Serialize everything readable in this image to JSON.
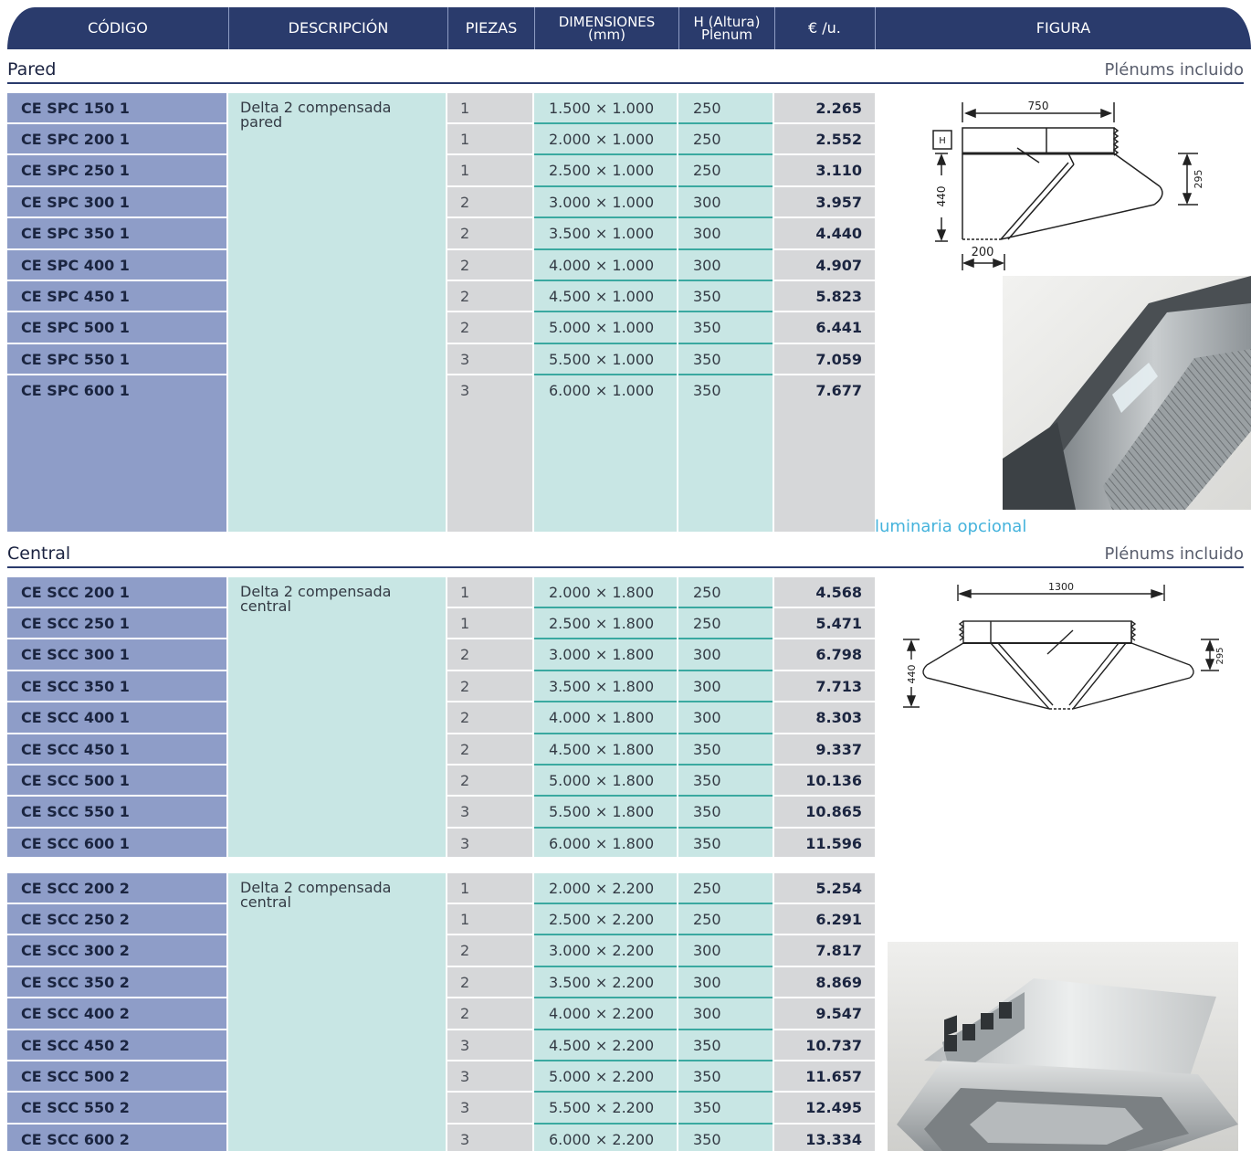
{
  "header": {
    "columns": [
      {
        "label": "CÓDIGO"
      },
      {
        "label": "DESCRIPCIÓN"
      },
      {
        "label": "PIEZAS"
      },
      {
        "label": "DIMENSIONES (mm)"
      },
      {
        "label": "H (Altura) Plenum"
      },
      {
        "label": "€ /u."
      },
      {
        "label": "FIGURA"
      }
    ]
  },
  "pared": {
    "title": "Pared",
    "note": "Plénums incluido",
    "description": "Delta 2 compensada pared",
    "rows": [
      {
        "code": "CE SPC 150 1",
        "pieces": "1",
        "dims": "1.500 × 1.000",
        "h": "250",
        "price": "2.265"
      },
      {
        "code": "CE SPC 200 1",
        "pieces": "1",
        "dims": "2.000 × 1.000",
        "h": "250",
        "price": "2.552"
      },
      {
        "code": "CE SPC 250 1",
        "pieces": "1",
        "dims": "2.500 × 1.000",
        "h": "250",
        "price": "3.110"
      },
      {
        "code": "CE SPC 300 1",
        "pieces": "2",
        "dims": "3.000 × 1.000",
        "h": "300",
        "price": "3.957"
      },
      {
        "code": "CE SPC 350 1",
        "pieces": "2",
        "dims": "3.500 × 1.000",
        "h": "300",
        "price": "4.440"
      },
      {
        "code": "CE SPC 400 1",
        "pieces": "2",
        "dims": "4.000 × 1.000",
        "h": "300",
        "price": "4.907"
      },
      {
        "code": "CE SPC 450 1",
        "pieces": "2",
        "dims": "4.500 × 1.000",
        "h": "350",
        "price": "5.823"
      },
      {
        "code": "CE SPC 500 1",
        "pieces": "2",
        "dims": "5.000 × 1.000",
        "h": "350",
        "price": "6.441"
      },
      {
        "code": "CE SPC 550 1",
        "pieces": "3",
        "dims": "5.500 × 1.000",
        "h": "350",
        "price": "7.059"
      },
      {
        "code": "CE SPC 600 1",
        "pieces": "3",
        "dims": "6.000 × 1.000",
        "h": "350",
        "price": "7.677"
      }
    ],
    "diagram": {
      "width": "750",
      "h": "H",
      "height": "440",
      "depth": "295",
      "front": "200"
    },
    "caption": "luminaria opcional"
  },
  "central": {
    "title": "Central",
    "note": "Plénums incluido",
    "diagram": {
      "width": "1300",
      "height": "440",
      "depth": "295"
    },
    "groups": [
      {
        "description": "Delta 2 compensada central",
        "rows": [
          {
            "code": "CE SCC 200 1",
            "pieces": "1",
            "dims": "2.000 × 1.800",
            "h": "250",
            "price": "4.568"
          },
          {
            "code": "CE SCC 250 1",
            "pieces": "1",
            "dims": "2.500 × 1.800",
            "h": "250",
            "price": "5.471"
          },
          {
            "code": "CE SCC 300 1",
            "pieces": "2",
            "dims": "3.000 × 1.800",
            "h": "300",
            "price": "6.798"
          },
          {
            "code": "CE SCC 350 1",
            "pieces": "2",
            "dims": "3.500 × 1.800",
            "h": "300",
            "price": "7.713"
          },
          {
            "code": "CE SCC 400 1",
            "pieces": "2",
            "dims": "4.000 × 1.800",
            "h": "300",
            "price": "8.303"
          },
          {
            "code": "CE SCC 450 1",
            "pieces": "2",
            "dims": "4.500 × 1.800",
            "h": "350",
            "price": "9.337"
          },
          {
            "code": "CE SCC 500 1",
            "pieces": "2",
            "dims": "5.000 × 1.800",
            "h": "350",
            "price": "10.136"
          },
          {
            "code": "CE SCC 550 1",
            "pieces": "3",
            "dims": "5.500 × 1.800",
            "h": "350",
            "price": "10.865"
          },
          {
            "code": "CE SCC 600 1",
            "pieces": "3",
            "dims": "6.000 × 1.800",
            "h": "350",
            "price": "11.596"
          }
        ]
      },
      {
        "description": "Delta 2 compensada central",
        "rows": [
          {
            "code": "CE SCC 200 2",
            "pieces": "1",
            "dims": "2.000 × 2.200",
            "h": "250",
            "price": "5.254"
          },
          {
            "code": "CE SCC 250 2",
            "pieces": "1",
            "dims": "2.500 × 2.200",
            "h": "250",
            "price": "6.291"
          },
          {
            "code": "CE SCC 300 2",
            "pieces": "2",
            "dims": "3.000 × 2.200",
            "h": "300",
            "price": "7.817"
          },
          {
            "code": "CE SCC 350 2",
            "pieces": "2",
            "dims": "3.500 × 2.200",
            "h": "300",
            "price": "8.869"
          },
          {
            "code": "CE SCC 400 2",
            "pieces": "2",
            "dims": "4.000 × 2.200",
            "h": "300",
            "price": "9.547"
          },
          {
            "code": "CE SCC 450 2",
            "pieces": "3",
            "dims": "4.500 × 2.200",
            "h": "350",
            "price": "10.737"
          },
          {
            "code": "CE SCC 500 2",
            "pieces": "3",
            "dims": "5.000 × 2.200",
            "h": "350",
            "price": "11.657"
          },
          {
            "code": "CE SCC 550 2",
            "pieces": "3",
            "dims": "5.500 × 2.200",
            "h": "350",
            "price": "12.495"
          },
          {
            "code": "CE SCC 600 2",
            "pieces": "3",
            "dims": "6.000 × 2.200",
            "h": "350",
            "price": "13.334"
          }
        ]
      }
    ]
  }
}
